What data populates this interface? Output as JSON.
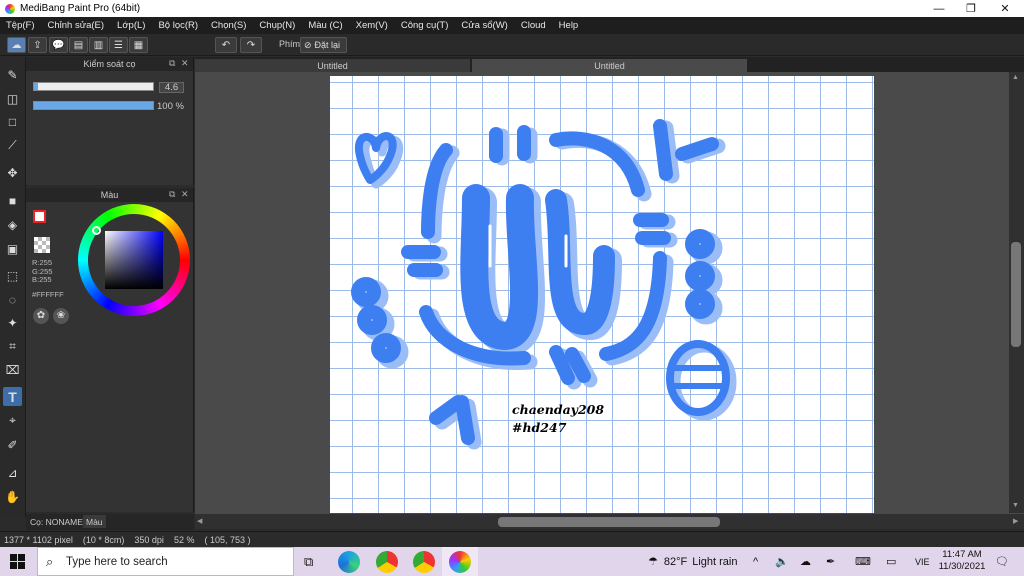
{
  "window": {
    "title": "MediBang Paint Pro (64bit)",
    "minimize": "—",
    "maximize": "❐",
    "close": "✕"
  },
  "menu": [
    "Tệp(F)",
    "Chỉnh sửa(E)",
    "Lớp(L)",
    "Bộ lọc(R)",
    "Chọn(S)",
    "Chụp(N)",
    "Màu (C)",
    "Xem(V)",
    "Công cụ(T)",
    "Cửa sổ(W)",
    "Cloud",
    "Help"
  ],
  "toolbar": {
    "shortcut_label": "Phím",
    "reset_label": "Đặt lại"
  },
  "tabs": [
    "Untitled",
    "Untitled"
  ],
  "brush_panel": {
    "title": "Kiểm soát cọ",
    "size_value": "4.6",
    "size_fraction": 0.03,
    "opacity_value": "100 %",
    "opacity_fraction": 1.0
  },
  "color_panel": {
    "title": "Màu",
    "r": "R:255",
    "g": "G:255",
    "b": "B:255",
    "hex": "#FFFFFF"
  },
  "layer_tabs": {
    "brush_tab": "Cọ: NONAME",
    "color_tab": "Màu"
  },
  "canvas": {
    "signature_line1": "chaenday208",
    "signature_line2": "#hd247",
    "ink_color": "#3d7ff0",
    "shadow_color": "#9bbdf7"
  },
  "status": {
    "pixel_size": "1377 * 1102 pixel",
    "cm_size": "(10 * 8cm)",
    "dpi": "350 dpi",
    "zoom": "52 %",
    "coords": "( 105, 753 )"
  },
  "taskbar": {
    "search_placeholder": "Type here to search",
    "weather_temp": "82°F",
    "weather_text": "Light rain",
    "language": "VIE",
    "time": "11:47 AM",
    "date": "11/30/2021"
  }
}
